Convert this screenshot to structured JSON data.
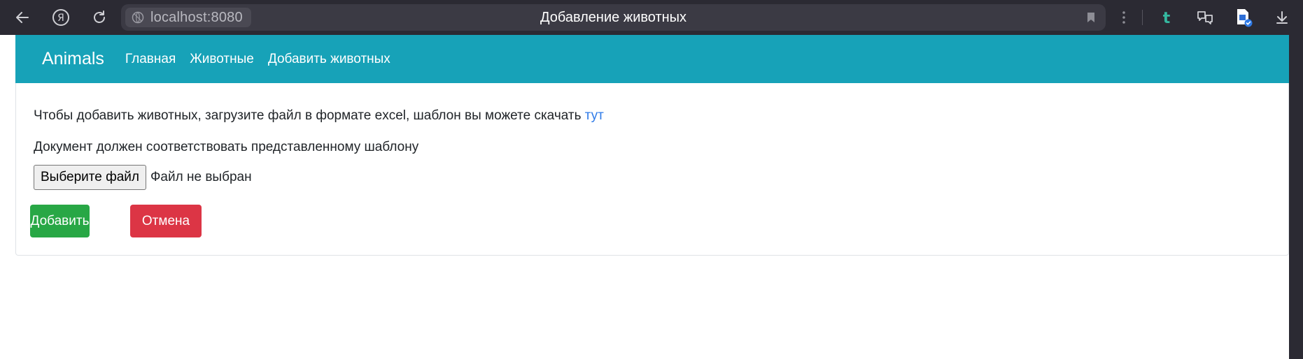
{
  "browser": {
    "url": "localhost:8080",
    "tab_title": "Добавление животных"
  },
  "navbar": {
    "brand": "Animals",
    "links": [
      "Главная",
      "Животные",
      "Добавить животных"
    ],
    "color": "#17a2b8"
  },
  "content": {
    "intro_text": "Чтобы добавить животных, загрузите файл в формате excel, шаблон вы можете скачать",
    "template_link": "тут",
    "requirement_text": "Документ должен соответствовать представленному шаблону",
    "file_button_label": "Выберите файл",
    "file_status": "Файл не выбран",
    "add_button_label": "Добавить",
    "cancel_button_label": "Отмена"
  },
  "colors": {
    "success": "#28a745",
    "danger": "#dc3545",
    "link": "#2f7be8"
  },
  "icons": [
    "back-icon",
    "yandex-icon",
    "reload-icon",
    "globe-icon",
    "bookmark-icon",
    "more-icon",
    "t-extension-icon",
    "translate-extension-icon",
    "document-extension-icon",
    "download-icon"
  ]
}
